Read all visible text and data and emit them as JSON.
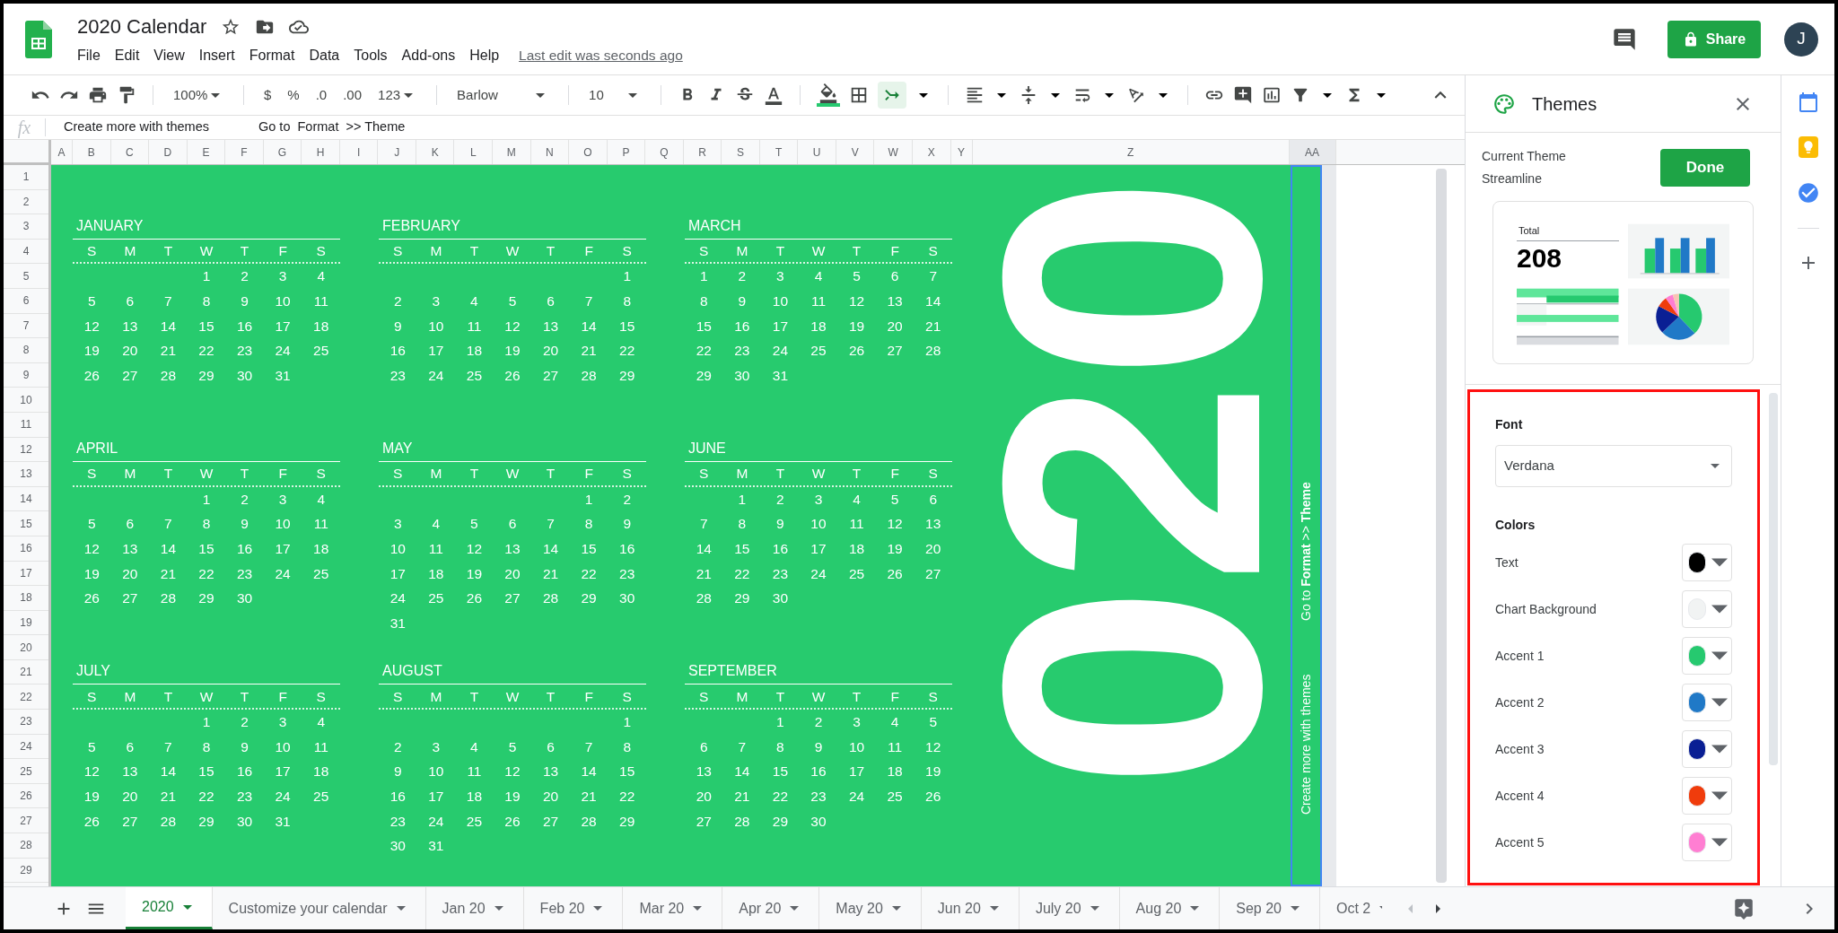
{
  "doc": {
    "title": "2020 Calendar",
    "last_edit": "Last edit was seconds ago"
  },
  "menu": [
    "File",
    "Edit",
    "View",
    "Insert",
    "Format",
    "Data",
    "Tools",
    "Add-ons",
    "Help"
  ],
  "share": {
    "label": "Share"
  },
  "avatar": {
    "initial": "J"
  },
  "toolbar": {
    "zoom": "100%",
    "currency": "$",
    "percent": "%",
    "decrease_decimals": ".0",
    "increase_decimals": ".00",
    "number_format": "123",
    "font": "Barlow",
    "font_size": "10",
    "merge": {
      "selected": true
    }
  },
  "formula_bar": {
    "fx": "fx",
    "content": [
      "Create more with themes",
      "Go to  Format  >> Theme"
    ]
  },
  "columns": [
    "A",
    "B",
    "C",
    "D",
    "E",
    "F",
    "G",
    "H",
    "I",
    "J",
    "K",
    "L",
    "M",
    "N",
    "O",
    "P",
    "Q",
    "R",
    "S",
    "T",
    "U",
    "V",
    "W",
    "X",
    "Y",
    "Z",
    "AA"
  ],
  "rows": [
    "1",
    "2",
    "3",
    "4",
    "5",
    "6",
    "7",
    "8",
    "9",
    "10",
    "11",
    "12",
    "13",
    "14",
    "15",
    "16",
    "17",
    "18",
    "19",
    "20",
    "21",
    "22",
    "23",
    "24",
    "25",
    "26",
    "27",
    "28",
    "29"
  ],
  "calendar": {
    "months": [
      {
        "name": "JANUARY",
        "weekdays": [
          "S",
          "M",
          "T",
          "W",
          "T",
          "F",
          "S"
        ],
        "weeks": [
          {
            "kind": "leading",
            "days": [
              "1",
              "2",
              "3",
              "4"
            ]
          },
          {
            "kind": "regular",
            "days": [
              "5",
              "6",
              "7",
              "8",
              "9",
              "10",
              "11"
            ]
          },
          {
            "kind": "regular",
            "days": [
              "12",
              "13",
              "14",
              "15",
              "16",
              "17",
              "18"
            ]
          },
          {
            "kind": "regular",
            "days": [
              "19",
              "20",
              "21",
              "22",
              "23",
              "24",
              "25"
            ]
          },
          {
            "kind": "regular",
            "days": [
              "26",
              "27",
              "28",
              "29",
              "30",
              "31"
            ]
          }
        ]
      },
      {
        "name": "FEBRUARY",
        "weekdays": [
          "S",
          "M",
          "T",
          "W",
          "T",
          "F",
          "S"
        ],
        "weeks": [
          {
            "kind": "leading",
            "days": [
              "1"
            ]
          },
          {
            "kind": "regular",
            "days": [
              "2",
              "3",
              "4",
              "5",
              "6",
              "7",
              "8"
            ]
          },
          {
            "kind": "regular",
            "days": [
              "9",
              "10",
              "11",
              "12",
              "13",
              "14",
              "15"
            ]
          },
          {
            "kind": "regular",
            "days": [
              "16",
              "17",
              "18",
              "19",
              "20",
              "21",
              "22"
            ]
          },
          {
            "kind": "regular",
            "days": [
              "23",
              "24",
              "25",
              "26",
              "27",
              "28",
              "29"
            ]
          }
        ]
      },
      {
        "name": "MARCH",
        "weekdays": [
          "S",
          "M",
          "T",
          "W",
          "T",
          "F",
          "S"
        ],
        "weeks": [
          {
            "kind": "regular",
            "days": [
              "1",
              "2",
              "3",
              "4",
              "5",
              "6",
              "7"
            ]
          },
          {
            "kind": "regular",
            "days": [
              "8",
              "9",
              "10",
              "11",
              "12",
              "13",
              "14"
            ]
          },
          {
            "kind": "regular",
            "days": [
              "15",
              "16",
              "17",
              "18",
              "19",
              "20",
              "21"
            ]
          },
          {
            "kind": "regular",
            "days": [
              "22",
              "23",
              "24",
              "25",
              "26",
              "27",
              "28"
            ]
          },
          {
            "kind": "regular",
            "days": [
              "29",
              "30",
              "31"
            ]
          }
        ]
      },
      {
        "name": "APRIL",
        "weekdays": [
          "S",
          "M",
          "T",
          "W",
          "T",
          "F",
          "S"
        ],
        "weeks": [
          {
            "kind": "leading",
            "days": [
              "1",
              "2",
              "3",
              "4"
            ]
          },
          {
            "kind": "regular",
            "days": [
              "5",
              "6",
              "7",
              "8",
              "9",
              "10",
              "11"
            ]
          },
          {
            "kind": "regular",
            "days": [
              "12",
              "13",
              "14",
              "15",
              "16",
              "17",
              "18"
            ]
          },
          {
            "kind": "regular",
            "days": [
              "19",
              "20",
              "21",
              "22",
              "23",
              "24",
              "25"
            ]
          },
          {
            "kind": "regular",
            "days": [
              "26",
              "27",
              "28",
              "29",
              "30"
            ]
          }
        ]
      },
      {
        "name": "MAY",
        "weekdays": [
          "S",
          "M",
          "T",
          "W",
          "T",
          "F",
          "S"
        ],
        "weeks": [
          {
            "kind": "leading",
            "days": [
              "1",
              "2"
            ]
          },
          {
            "kind": "regular",
            "days": [
              "3",
              "4",
              "5",
              "6",
              "7",
              "8",
              "9"
            ]
          },
          {
            "kind": "regular",
            "days": [
              "10",
              "11",
              "12",
              "13",
              "14",
              "15",
              "16"
            ]
          },
          {
            "kind": "regular",
            "days": [
              "17",
              "18",
              "19",
              "20",
              "21",
              "22",
              "23"
            ]
          },
          {
            "kind": "regular",
            "days": [
              "24",
              "25",
              "26",
              "27",
              "28",
              "29",
              "30"
            ]
          },
          {
            "kind": "regular",
            "days": [
              "31"
            ]
          }
        ]
      },
      {
        "name": "JUNE",
        "weekdays": [
          "S",
          "M",
          "T",
          "W",
          "T",
          "F",
          "S"
        ],
        "weeks": [
          {
            "kind": "leading",
            "days": [
              "1",
              "2",
              "3",
              "4",
              "5",
              "6"
            ]
          },
          {
            "kind": "regular",
            "days": [
              "7",
              "8",
              "9",
              "10",
              "11",
              "12",
              "13"
            ]
          },
          {
            "kind": "regular",
            "days": [
              "14",
              "15",
              "16",
              "17",
              "18",
              "19",
              "20"
            ]
          },
          {
            "kind": "regular",
            "days": [
              "21",
              "22",
              "23",
              "24",
              "25",
              "26",
              "27"
            ]
          },
          {
            "kind": "regular",
            "days": [
              "28",
              "29",
              "30"
            ]
          }
        ]
      },
      {
        "name": "JULY",
        "weekdays": [
          "S",
          "M",
          "T",
          "W",
          "T",
          "F",
          "S"
        ],
        "weeks": [
          {
            "kind": "leading",
            "days": [
              "1",
              "2",
              "3",
              "4"
            ]
          },
          {
            "kind": "regular",
            "days": [
              "5",
              "6",
              "7",
              "8",
              "9",
              "10",
              "11"
            ]
          },
          {
            "kind": "regular",
            "days": [
              "12",
              "13",
              "14",
              "15",
              "16",
              "17",
              "18"
            ]
          },
          {
            "kind": "regular",
            "days": [
              "19",
              "20",
              "21",
              "22",
              "23",
              "24",
              "25"
            ]
          },
          {
            "kind": "regular",
            "days": [
              "26",
              "27",
              "28",
              "29",
              "30",
              "31"
            ]
          }
        ]
      },
      {
        "name": "AUGUST",
        "weekdays": [
          "S",
          "M",
          "T",
          "W",
          "T",
          "F",
          "S"
        ],
        "weeks": [
          {
            "kind": "leading",
            "days": [
              "1"
            ]
          },
          {
            "kind": "regular",
            "days": [
              "2",
              "3",
              "4",
              "5",
              "6",
              "7",
              "8"
            ]
          },
          {
            "kind": "regular",
            "days": [
              "9",
              "10",
              "11",
              "12",
              "13",
              "14",
              "15"
            ]
          },
          {
            "kind": "regular",
            "days": [
              "16",
              "17",
              "18",
              "19",
              "20",
              "21",
              "22"
            ]
          },
          {
            "kind": "regular",
            "days": [
              "23",
              "24",
              "25",
              "26",
              "27",
              "28",
              "29"
            ]
          },
          {
            "kind": "regular",
            "days": [
              "30",
              "31"
            ]
          }
        ]
      },
      {
        "name": "SEPTEMBER",
        "weekdays": [
          "S",
          "M",
          "T",
          "W",
          "T",
          "F",
          "S"
        ],
        "weeks": [
          {
            "kind": "leading",
            "days": [
              "1",
              "2",
              "3",
              "4",
              "5"
            ]
          },
          {
            "kind": "regular",
            "days": [
              "6",
              "7",
              "8",
              "9",
              "10",
              "11",
              "12"
            ]
          },
          {
            "kind": "regular",
            "days": [
              "13",
              "14",
              "15",
              "16",
              "17",
              "18",
              "19"
            ]
          },
          {
            "kind": "regular",
            "days": [
              "20",
              "21",
              "22",
              "23",
              "24",
              "25",
              "26"
            ]
          },
          {
            "kind": "regular",
            "days": [
              "27",
              "28",
              "29",
              "30"
            ]
          }
        ]
      }
    ],
    "year": "020",
    "side_note": [
      "Create more with themes",
      "Go to **Format** >> **Theme**"
    ]
  },
  "sheet_tabs": [
    {
      "label": "2020",
      "selected": true
    },
    {
      "label": "Customize your calendar",
      "selected": false
    },
    {
      "label": "Jan 20",
      "selected": false
    },
    {
      "label": "Feb 20",
      "selected": false
    },
    {
      "label": "Mar 20",
      "selected": false
    },
    {
      "label": "Apr 20",
      "selected": false
    },
    {
      "label": "May 20",
      "selected": false
    },
    {
      "label": "Jun 20",
      "selected": false
    },
    {
      "label": "July 20",
      "selected": false
    },
    {
      "label": "Aug 20",
      "selected": false
    },
    {
      "label": "Sep 20",
      "selected": false
    },
    {
      "label": "Oct 2",
      "selected": false
    }
  ],
  "themes_panel": {
    "title": "Themes",
    "current_theme_label": "Current Theme",
    "current_theme": "Streamline",
    "done": "Done",
    "preview": {
      "total_label": "Total",
      "total_value": "208"
    },
    "font_label": "Font",
    "font": "Verdana",
    "colors_label": "Colors",
    "colors": [
      {
        "name": "Text",
        "color": "#000000"
      },
      {
        "name": "Chart Background",
        "color": "#f1f3f3"
      },
      {
        "name": "Accent 1",
        "color": "#26c96f"
      },
      {
        "name": "Accent 2",
        "color": "#2079c7"
      },
      {
        "name": "Accent 3",
        "color": "#0a1f94"
      },
      {
        "name": "Accent 4",
        "color": "#f03c0c"
      },
      {
        "name": "Accent 5",
        "color": "#ff7ed2"
      }
    ]
  }
}
